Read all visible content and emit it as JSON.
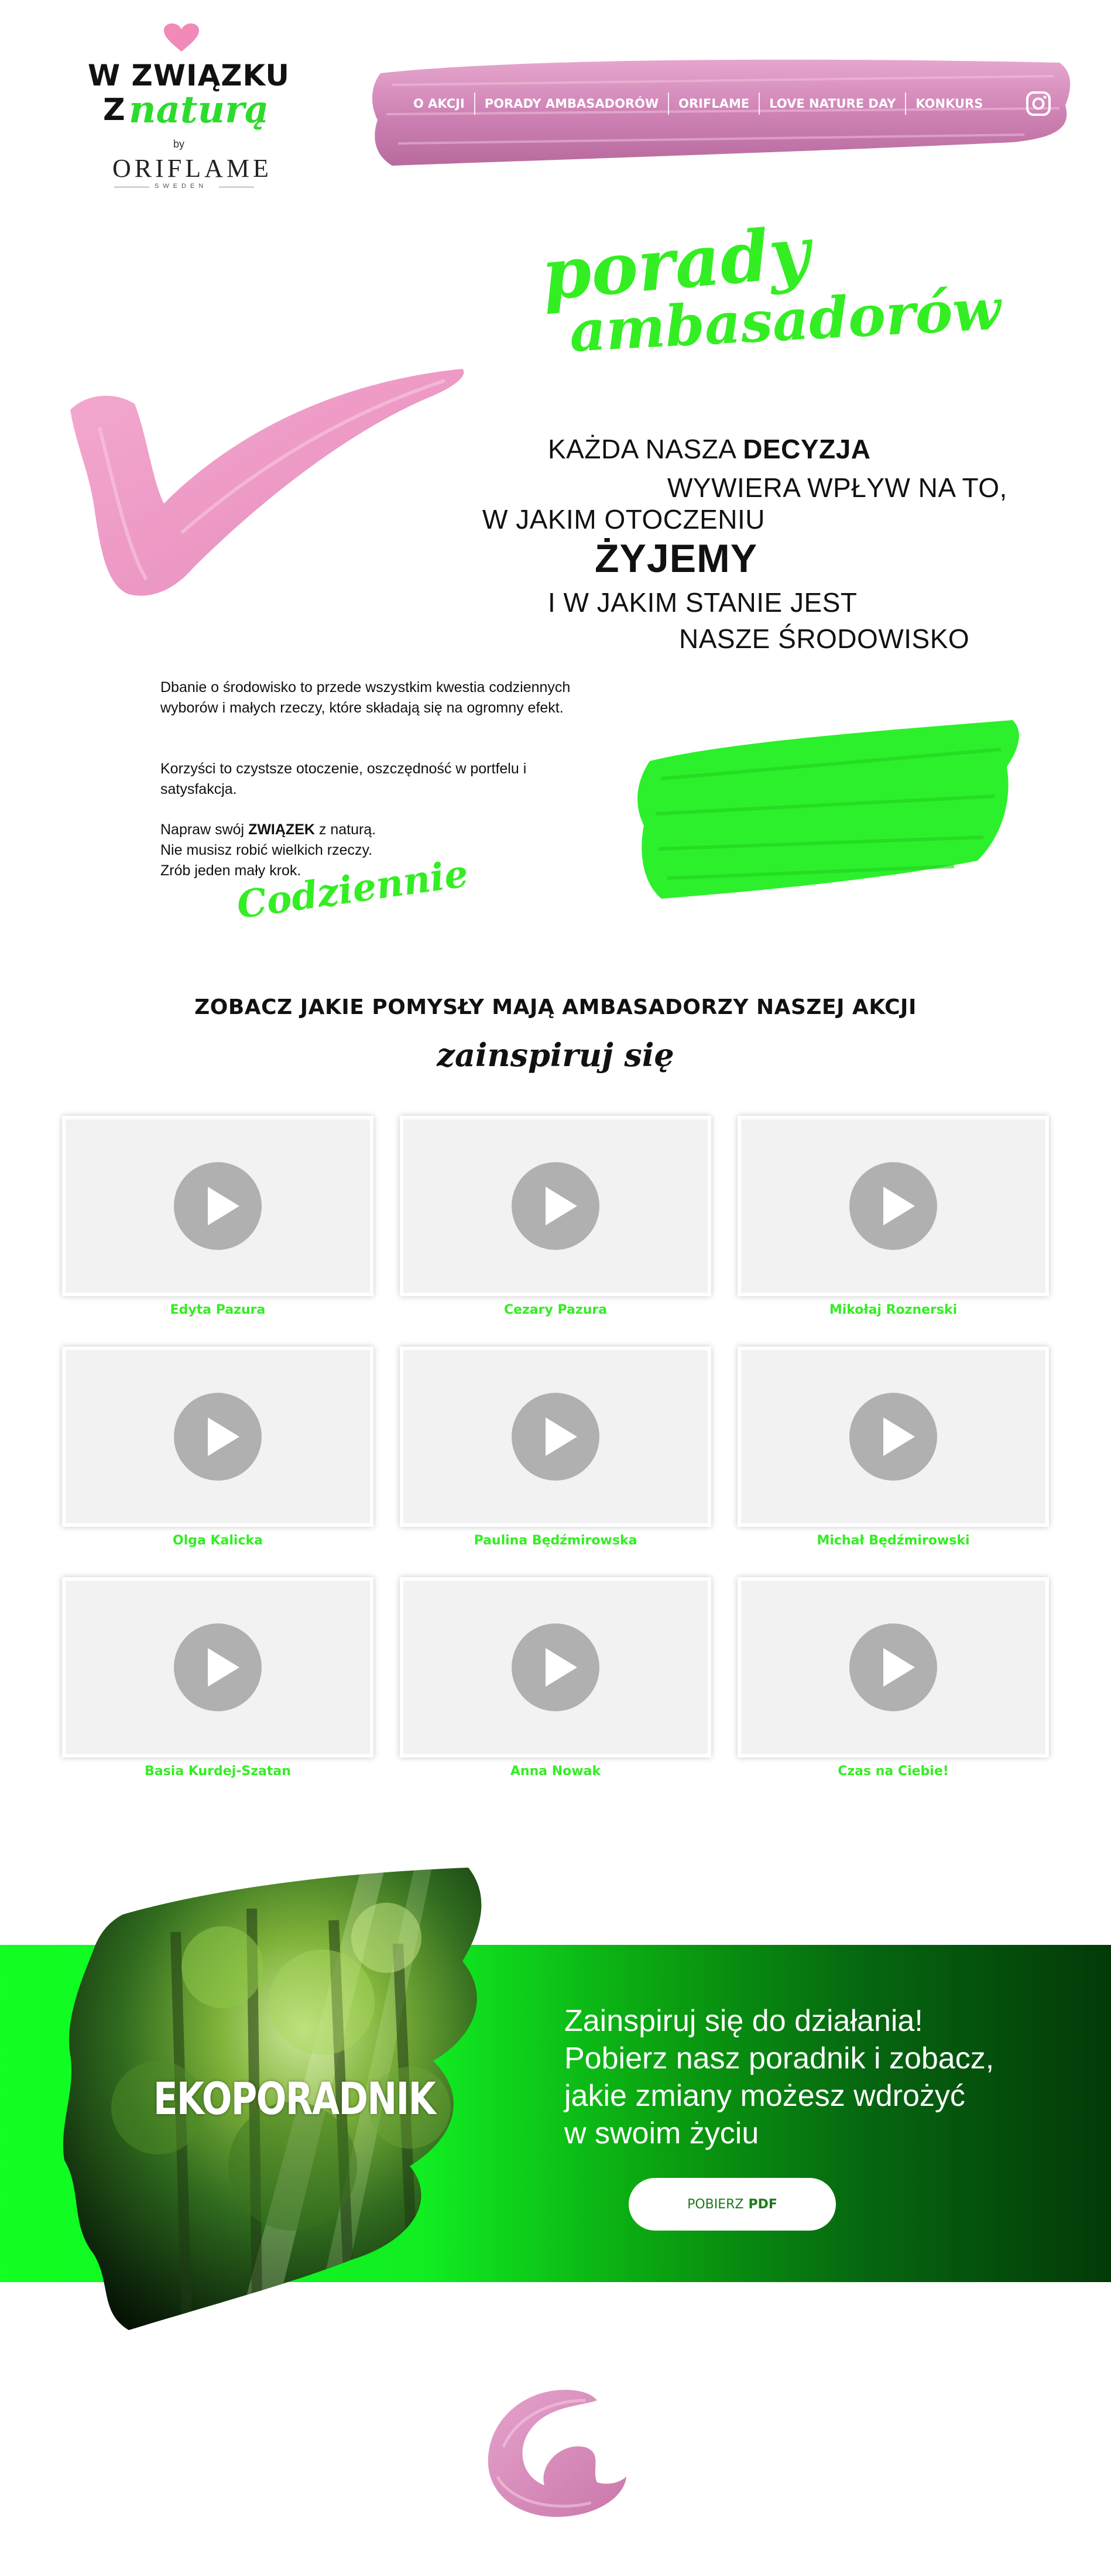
{
  "logo": {
    "line1": "W ZWIĄZKU",
    "line2": "Z",
    "script": "naturą",
    "by": "by",
    "brand": "ORIFLAME",
    "sweden": "SWEDEN"
  },
  "nav": {
    "items": [
      {
        "label": "O AKCJI"
      },
      {
        "label": "PORADY AMBASADORÓW"
      },
      {
        "label": "ORIFLAME"
      },
      {
        "label": "LOVE NATURE DAY"
      },
      {
        "label": "KONKURS"
      }
    ],
    "icon": "instagram-icon"
  },
  "section": {
    "title_line1": "porady",
    "title_line2": "ambasadorów"
  },
  "quote": {
    "l1_a": "KAŻDA NASZA ",
    "l1_b": "DECYZJA",
    "l2": "WYWIERA WPŁYW NA TO,",
    "l3": "W JAKIM OTOCZENIU",
    "l4": "ŻYJEMY",
    "l5": "I W JAKIM STANIE JEST",
    "l6": "NASZE ŚRODOWISKO"
  },
  "intro": {
    "p1": "Dbanie o środowisko to przede wszystkim kwestia codziennych wyborów i małych rzeczy, które składają się na ogromny efekt.",
    "p2": "Korzyści to czystsze otoczenie, oszczędność w portfelu i satysfakcja.",
    "p3_a": "Napraw swój ",
    "p3_b": "ZWIĄZEK",
    "p3_c": " z naturą.",
    "p3_l2": "Nie musisz robić wielkich rzeczy.",
    "p3_l3": "Zrób jeden mały krok.",
    "script": "Codziennie"
  },
  "ambassadors": {
    "title": "ZOBACZ JAKIE POMYSŁY MAJĄ AMBASADORZY NASZEJ AKCJI",
    "subtitle": "zainspiruj się",
    "videos": [
      {
        "name": "Edyta Pazura"
      },
      {
        "name": "Cezary Pazura"
      },
      {
        "name": "Mikołaj Roznerski"
      },
      {
        "name": "Olga Kalicka"
      },
      {
        "name": "Paulina Będźmirowska"
      },
      {
        "name": "Michał Będźmirowski"
      },
      {
        "name": "Basia Kurdej-Szatan"
      },
      {
        "name": "Anna Nowak"
      },
      {
        "name": "Czas na Ciebie!"
      }
    ]
  },
  "eco": {
    "word": "EKOPORADNIK",
    "line1": "Zainspiruj się do działania!",
    "line2": "Pobierz nasz poradnik i zobacz,",
    "line3": "jakie zmiany możesz wdrożyć",
    "line4": "w swoim życiu",
    "btn_a": "POBIERZ",
    "btn_b": "PDF"
  },
  "colors": {
    "brand_green": "#33ee22",
    "brand_pink": "#d98ab8",
    "text": "#111111"
  }
}
